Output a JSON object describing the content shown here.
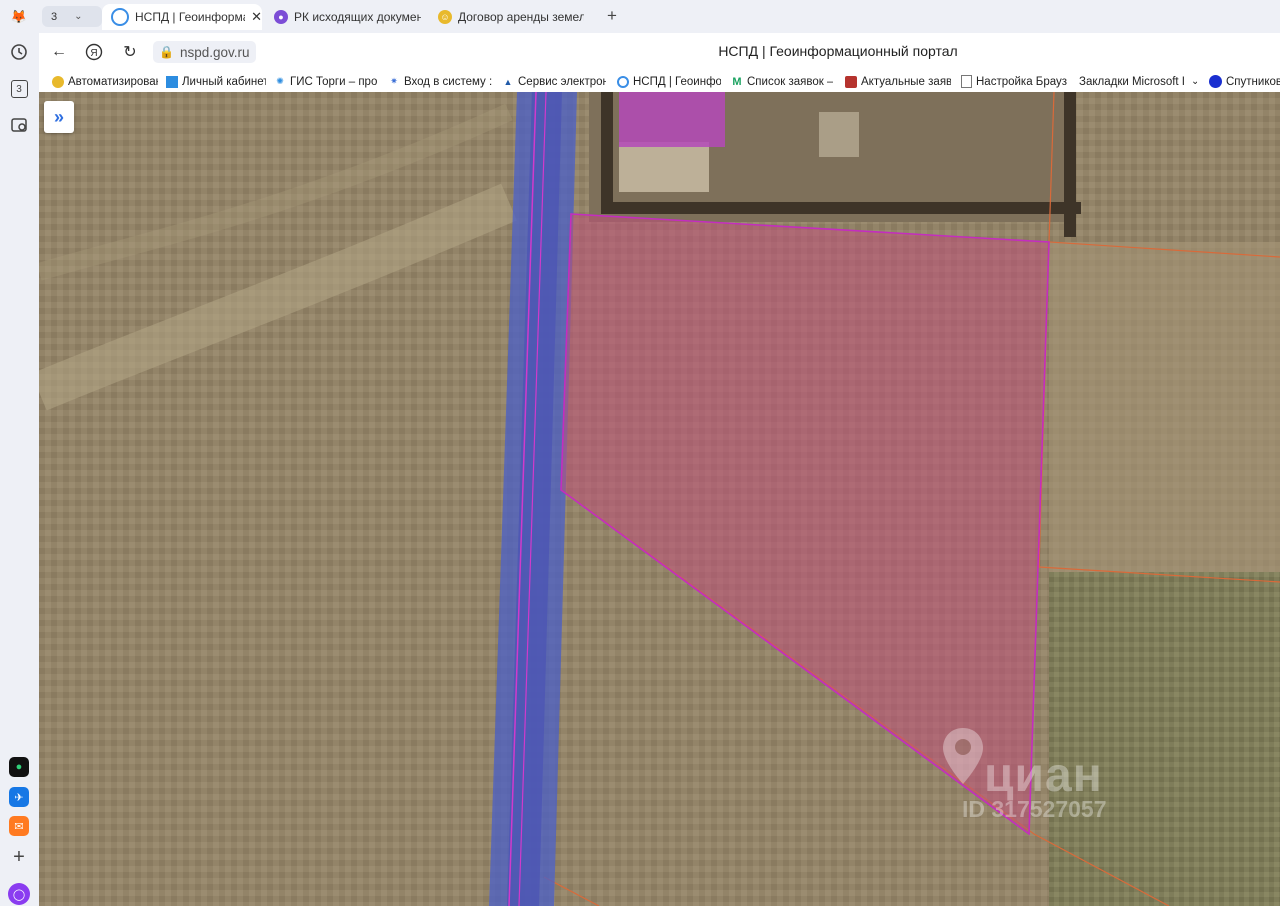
{
  "tabs": {
    "count": "3",
    "items": [
      {
        "title": "НСПД | Геоинформационный портал",
        "favicon": "nspd-icon",
        "color": "#3a8ee6"
      },
      {
        "title": "РК исходящих документов",
        "favicon": "doc-registry-icon",
        "color": "#7c4dd6"
      },
      {
        "title": "Договор аренды земельного участка",
        "favicon": "gosuslugi-icon",
        "color": "#e8b92c"
      }
    ]
  },
  "address": {
    "url": "nspd.gov.ru",
    "page_title": "НСПД | Геоинформационный портал"
  },
  "bookmarks": [
    {
      "label": "Автоматизирован",
      "icon": "gosuslugi-icon",
      "color": "#e8b92c"
    },
    {
      "label": "Личный кабинет",
      "icon": "cabinet-icon",
      "color": "#2d8de0"
    },
    {
      "label": "ГИС Торги – прод",
      "icon": "gis-torgi-icon",
      "color": "#2d8de0"
    },
    {
      "label": "Вход в систему :: I",
      "icon": "login-globe-icon",
      "color": "#3b6fd6"
    },
    {
      "label": "Сервис электрон",
      "icon": "mountain-icon",
      "color": "#1f5aa8"
    },
    {
      "label": "НСПД | Геоинфор",
      "icon": "nspd-icon",
      "color": "#3a8ee6"
    },
    {
      "label": "Список заявок —",
      "icon": "gmail-icon",
      "color": "#1aa260"
    },
    {
      "label": "Актуальные заявл",
      "icon": "cube-icon",
      "color": "#b5332e"
    },
    {
      "label": "Настройка Брауз",
      "icon": "page-icon",
      "color": "#777777"
    },
    {
      "label": "Закладки Microsoft I",
      "icon": "",
      "color": ""
    },
    {
      "label": "Спутников",
      "icon": "sputnik-icon",
      "color": "#1a2fd0"
    }
  ],
  "map": {
    "watermark_brand": "циан",
    "watermark_id": "ID 317527057",
    "parcel_fill": "#c0507a",
    "road_color": "#4a5fc8"
  }
}
